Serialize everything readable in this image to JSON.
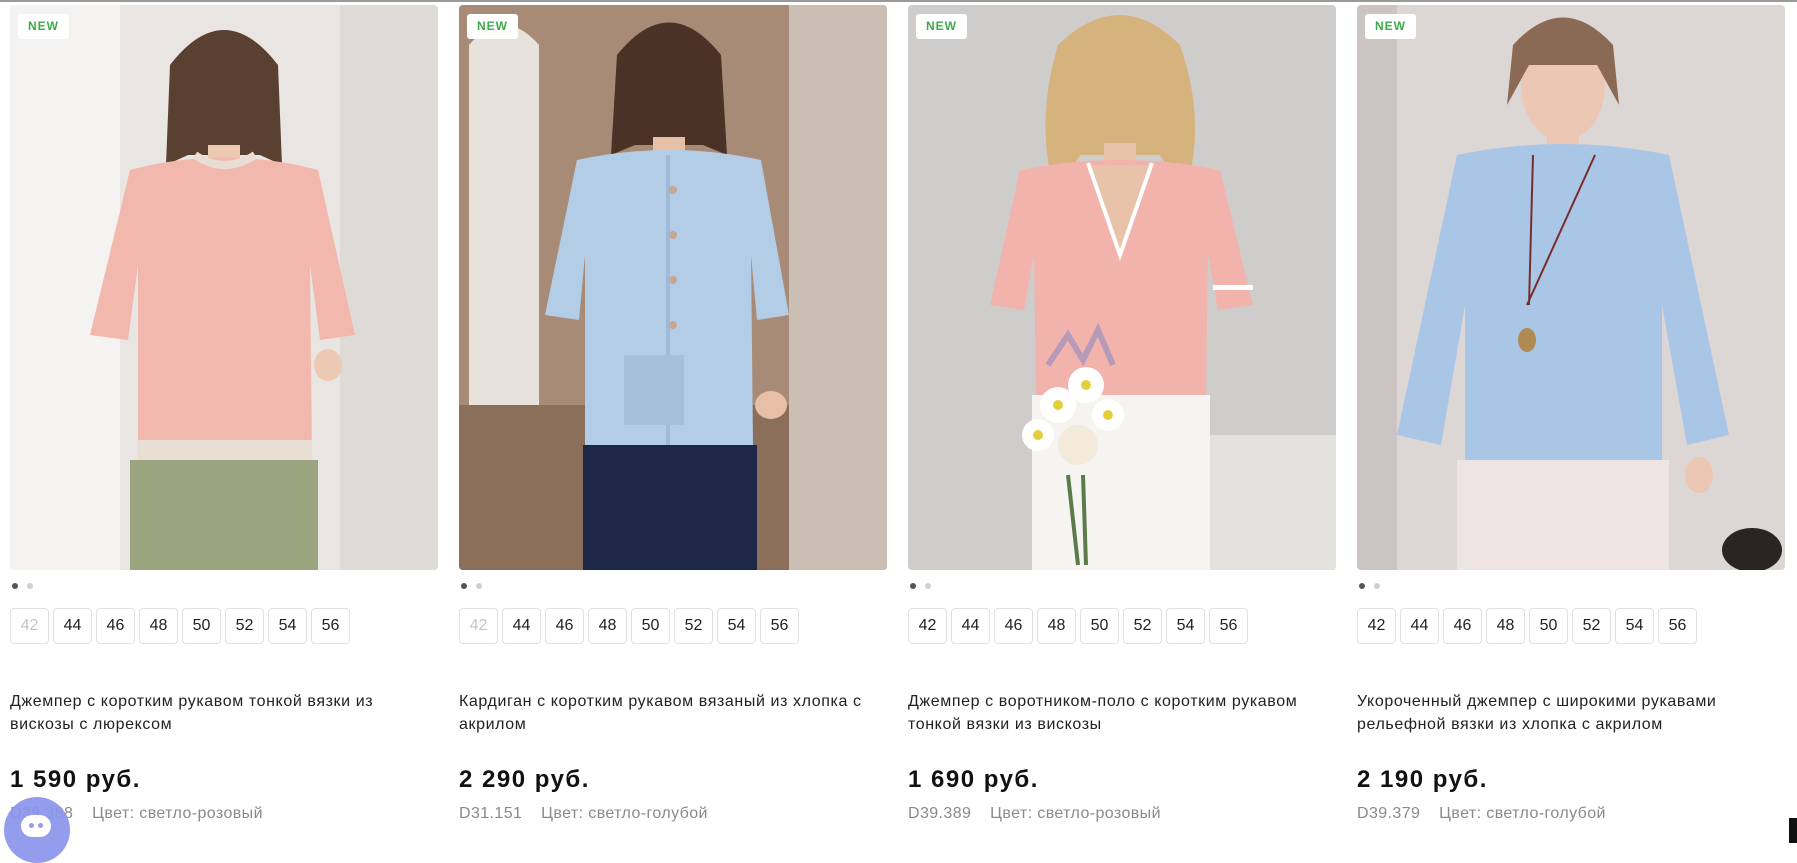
{
  "products": [
    {
      "badge": "NEW",
      "sizes": [
        {
          "label": "42",
          "available": false
        },
        {
          "label": "44",
          "available": true
        },
        {
          "label": "46",
          "available": true
        },
        {
          "label": "48",
          "available": true
        },
        {
          "label": "50",
          "available": true
        },
        {
          "label": "52",
          "available": true
        },
        {
          "label": "54",
          "available": true
        },
        {
          "label": "56",
          "available": true
        }
      ],
      "title": "Джемпер с коротким рукавом тонкой вязки из вискозы с люрексом",
      "price": "1 590 руб.",
      "sku": "D39.388",
      "color_label": "Цвет: светло-розовый",
      "garment_color": "#f2b8ae",
      "bottom_color": "#9aa47f",
      "trim_color": "#e8ded3",
      "bg_color": "#e9e5e2"
    },
    {
      "badge": "NEW",
      "sizes": [
        {
          "label": "42",
          "available": false
        },
        {
          "label": "44",
          "available": true
        },
        {
          "label": "46",
          "available": true
        },
        {
          "label": "48",
          "available": true
        },
        {
          "label": "50",
          "available": true
        },
        {
          "label": "52",
          "available": true
        },
        {
          "label": "54",
          "available": true
        },
        {
          "label": "56",
          "available": true
        }
      ],
      "title": "Кардиган с коротким рукавом вязаный из хлопка с акрилом",
      "price": "2 290 руб.",
      "sku": "D31.151",
      "color_label": "Цвет: светло-голубой",
      "garment_color": "#b4cde7",
      "bottom_color": "#1d2746",
      "trim_color": "#c4a990",
      "bg_color": "#a88b76"
    },
    {
      "badge": "NEW",
      "sizes": [
        {
          "label": "42",
          "available": true
        },
        {
          "label": "44",
          "available": true
        },
        {
          "label": "46",
          "available": true
        },
        {
          "label": "48",
          "available": true
        },
        {
          "label": "50",
          "available": true
        },
        {
          "label": "52",
          "available": true
        },
        {
          "label": "54",
          "available": true
        },
        {
          "label": "56",
          "available": true
        }
      ],
      "title": "Джемпер с воротником-поло с коротким рукавом тонкой вязки из вискозы",
      "price": "1 690 руб.",
      "sku": "D39.389",
      "color_label": "Цвет: светло-розовый",
      "garment_color": "#f2b3ad",
      "bottom_color": "#f6f4f1",
      "trim_color": "#ffffff",
      "bg_color": "#cfcdcb"
    },
    {
      "badge": "NEW",
      "sizes": [
        {
          "label": "42",
          "available": true
        },
        {
          "label": "44",
          "available": true
        },
        {
          "label": "46",
          "available": true
        },
        {
          "label": "48",
          "available": true
        },
        {
          "label": "50",
          "available": true
        },
        {
          "label": "52",
          "available": true
        },
        {
          "label": "54",
          "available": true
        },
        {
          "label": "56",
          "available": true
        }
      ],
      "title": "Укороченный джемпер с широкими рукавами рельефной вязки из хлопка с акрилом",
      "price": "2 190 руб.",
      "sku": "D39.379",
      "color_label": "Цвет: светло-голубой",
      "garment_color": "#a9c6e6",
      "bottom_color": "#efe4e4",
      "trim_color": "#a9c6e6",
      "bg_color": "#dcd6d4"
    }
  ],
  "gallery_dots": 2,
  "colors": {
    "badge_text": "#3cab4a",
    "chat_button": "#8c95ec"
  },
  "chat_icon": "chat-bubble-icon"
}
